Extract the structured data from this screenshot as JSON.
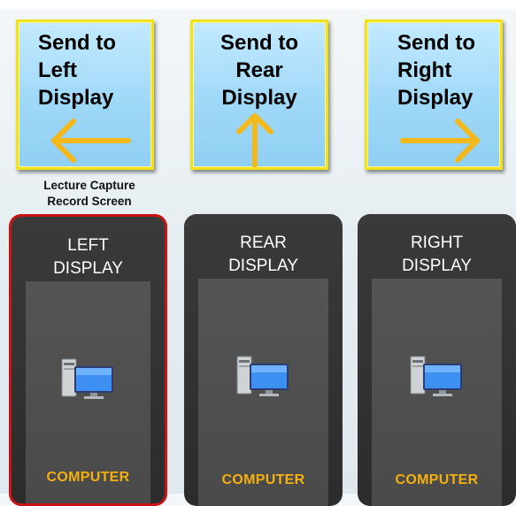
{
  "send_buttons": [
    {
      "label": "Send to\nLeft\nDisplay",
      "icon": "arrow-left-icon"
    },
    {
      "label": "Send to\nRear\nDisplay",
      "icon": "arrow-up-icon"
    },
    {
      "label": "Send to\nRight\nDisplay",
      "icon": "arrow-right-icon"
    }
  ],
  "lecture_capture_label": "Lecture Capture\nRecord Screen",
  "displays": [
    {
      "title": "LEFT\nDISPLAY",
      "source": "COMPUTER",
      "selected": true
    },
    {
      "title": "REAR\nDISPLAY",
      "source": "COMPUTER",
      "selected": false
    },
    {
      "title": "RIGHT\nDISPLAY",
      "source": "COMPUTER",
      "selected": false
    }
  ],
  "colors": {
    "button_border": "#f1e21c",
    "button_fill": "#9fd8f8",
    "arrow": "#f5b81a",
    "panel": "#2c2c2c",
    "source_text": "#f4b010",
    "selected_border": "#c81414"
  }
}
